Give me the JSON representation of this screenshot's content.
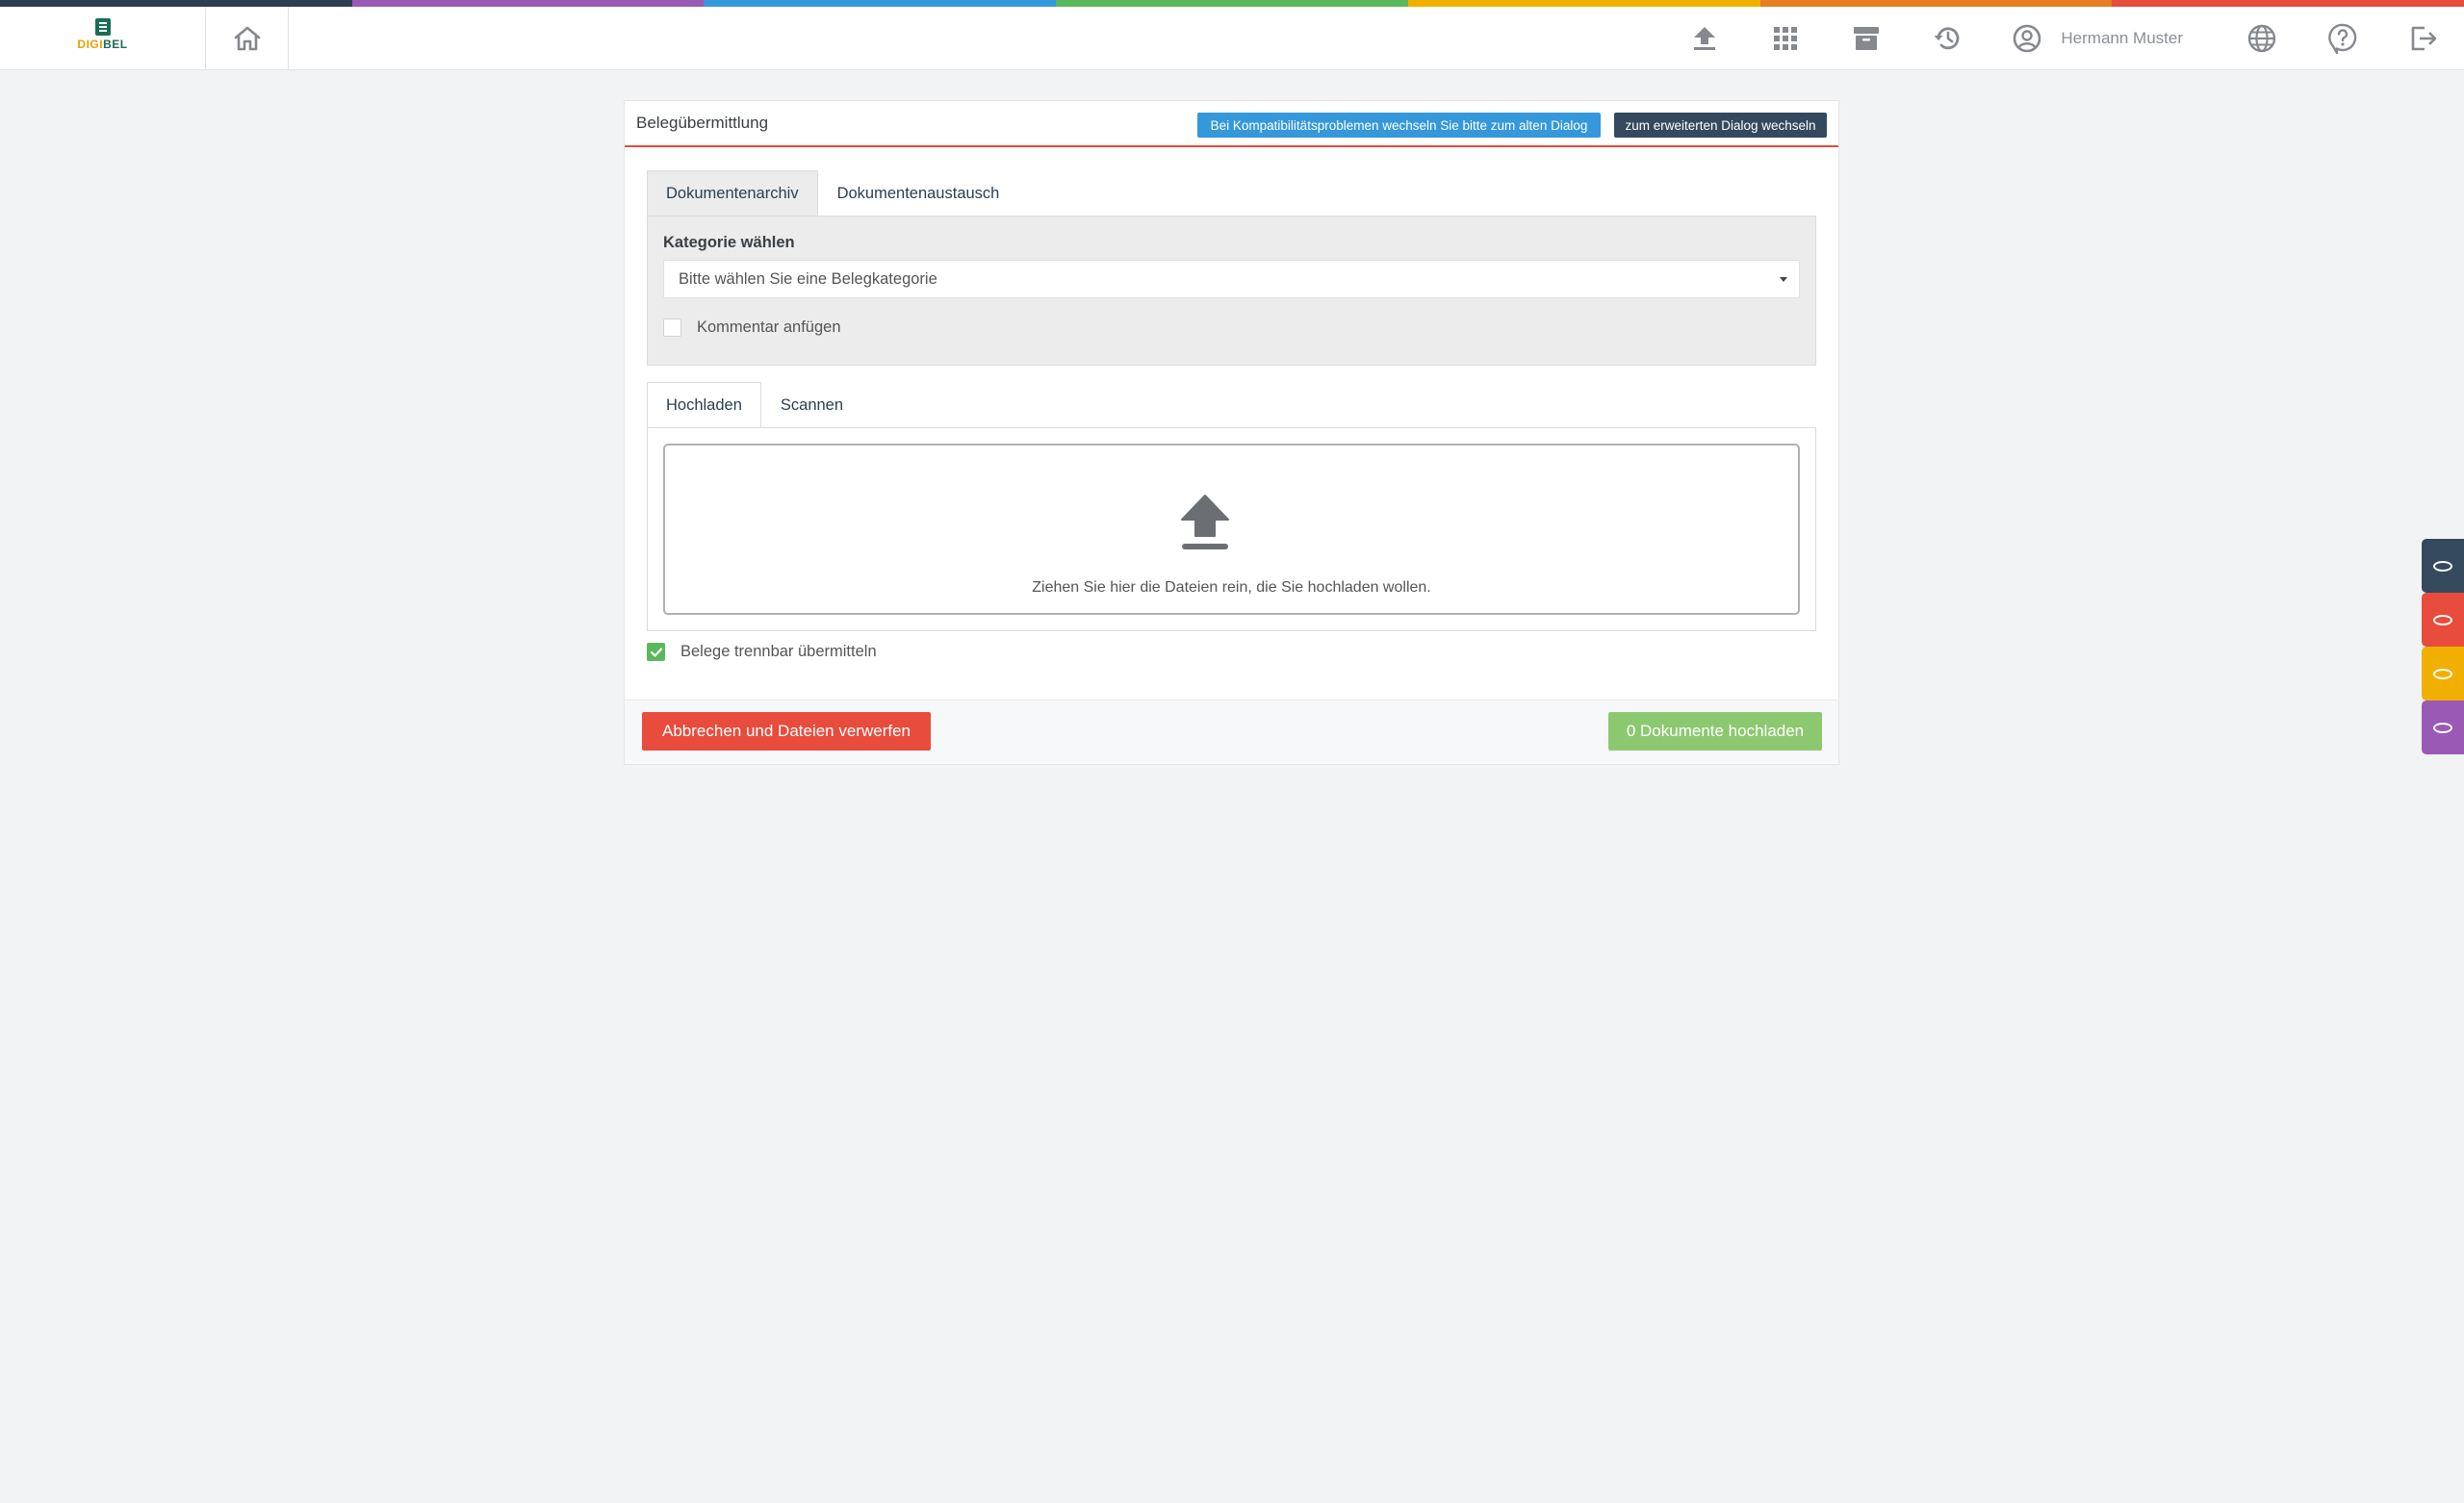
{
  "colors": {
    "rainbow": [
      "#2c3e50",
      "#9b59b6",
      "#3498db",
      "#5cb85c",
      "#f1b000",
      "#e67e22",
      "#e74c3c"
    ],
    "accent_red": "#e74c3c",
    "accent_blue": "#3498db",
    "dark": "#34495e",
    "success": "#8cc870",
    "icon_gray": "#85898e",
    "side_tabs": [
      "#34495e",
      "#e74c3c",
      "#f1b000",
      "#9b59b6"
    ]
  },
  "header": {
    "logo": {
      "text_a": "DIGI",
      "text_b": "BEL"
    },
    "home_icon": "home-icon",
    "icons": [
      "upload-icon",
      "apps-grid-icon",
      "archive-icon",
      "history-icon"
    ],
    "user": {
      "icon": "user-circle-icon",
      "name": "Hermann Muster"
    },
    "right_icons": [
      "globe-icon",
      "help-icon",
      "logout-icon"
    ]
  },
  "panel": {
    "title": "Belegübermittlung",
    "compat_button": "Bei Kompatibilitätsproblemen wechseln Sie bitte zum alten Dialog",
    "extended_button": "zum erweiterten Dialog wechseln",
    "tabs_top": [
      {
        "label": "Dokumentenarchiv",
        "active": true
      },
      {
        "label": "Dokumentenaustausch",
        "active": false
      }
    ],
    "category": {
      "label": "Kategorie wählen",
      "select_value": "Bitte wählen Sie eine Belegkategorie",
      "comment_checkbox": {
        "label": "Kommentar anfügen",
        "checked": false
      }
    },
    "tabs_upload": [
      {
        "label": "Hochladen",
        "active": true
      },
      {
        "label": "Scannen",
        "active": false
      }
    ],
    "dropzone": {
      "icon": "upload-icon",
      "text": "Ziehen Sie hier die Dateien rein, die Sie hochladen wollen."
    },
    "separable_checkbox": {
      "label": "Belege trennbar übermitteln",
      "checked": true
    },
    "footer": {
      "cancel_button": "Abbrechen und Dateien verwerfen",
      "upload_button": "0 Dokumente hochladen"
    }
  },
  "side_tabs": [
    "side-tab-1",
    "side-tab-2",
    "side-tab-3",
    "side-tab-4"
  ]
}
